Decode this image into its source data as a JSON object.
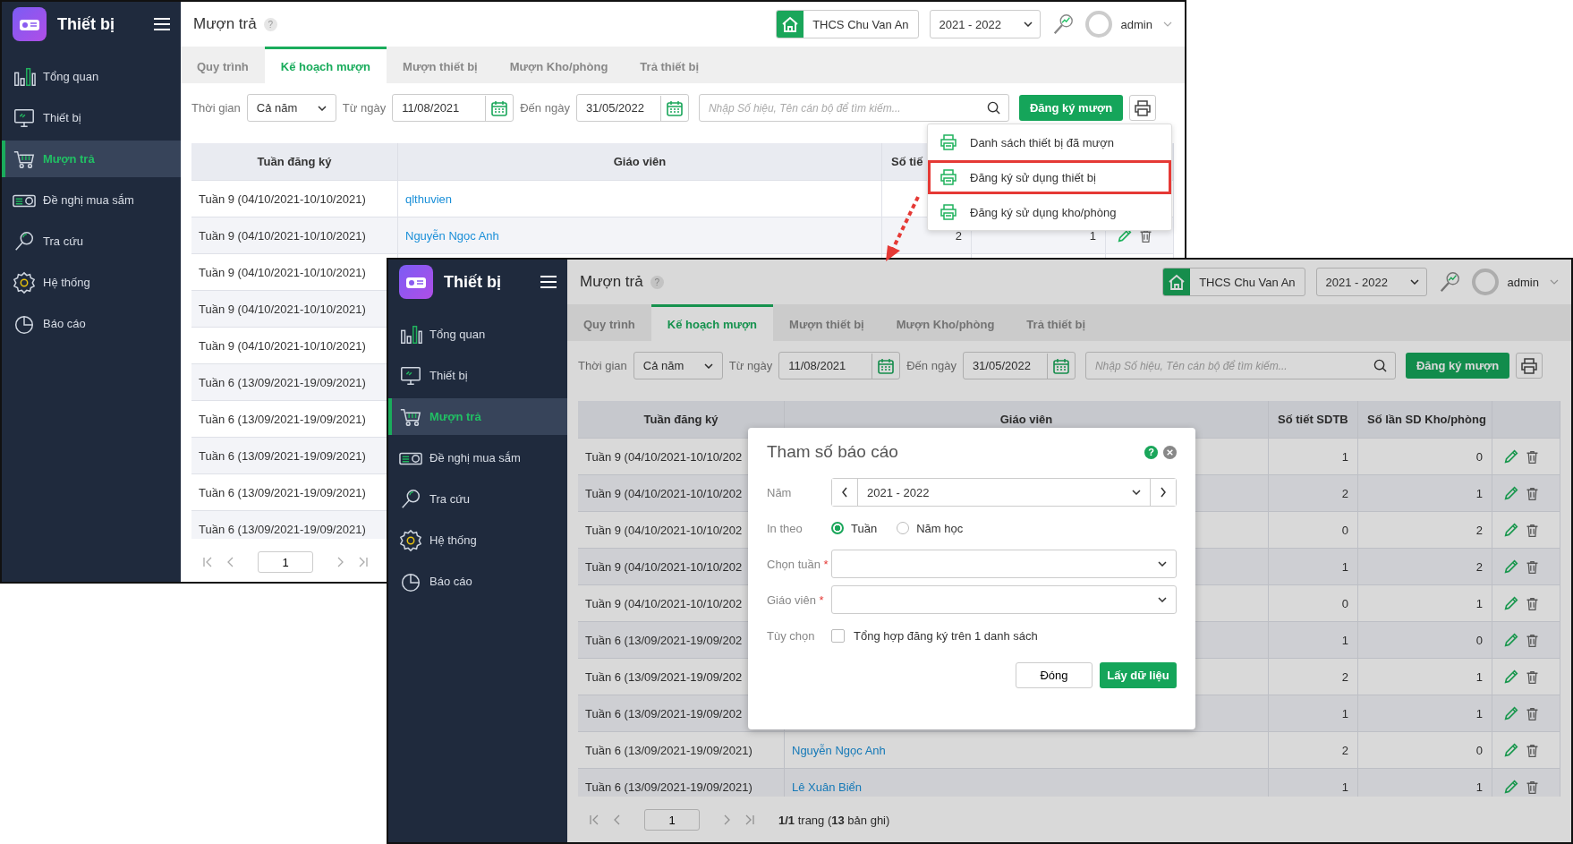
{
  "windows": [
    {
      "app_title": "Thiết bị",
      "nav": [
        {
          "label": "Tổng quan",
          "selected": false
        },
        {
          "label": "Thiết bị",
          "selected": false
        },
        {
          "label": "Mượn trả",
          "selected": true
        },
        {
          "label": "Đề nghị mua sắm",
          "selected": false
        },
        {
          "label": "Tra cứu",
          "selected": false
        },
        {
          "label": "Hệ thống",
          "selected": false
        },
        {
          "label": "Báo cáo",
          "selected": false
        }
      ],
      "page_title": "Mượn trả",
      "help_mark": "?",
      "school": "THCS Chu Van An",
      "year": "2021 - 2022",
      "user": "admin",
      "tabs": [
        {
          "label": "Quy trình",
          "selected": false
        },
        {
          "label": "Kế hoạch mượn",
          "selected": true
        },
        {
          "label": "Mượn thiết bị",
          "selected": false
        },
        {
          "label": "Mượn Kho/phòng",
          "selected": false
        },
        {
          "label": "Trả thiết bị",
          "selected": false
        }
      ],
      "filter": {
        "time_label": "Thời gian",
        "time_value": "Cả năm",
        "from_label": "Từ ngày",
        "from_value": "11/08/2021",
        "to_label": "Đến ngày",
        "to_value": "31/05/2022",
        "search_placeholder": "Nhập Số hiệu, Tên cán bộ để tìm kiếm...",
        "register_button": "Đăng ký mượn"
      },
      "columns": [
        "Tuần đăng ký",
        "Giáo viên",
        "Số tiế"
      ],
      "rows": [
        {
          "week": "Tuần 9 (04/10/2021-10/10/2021)",
          "teacher": "qlthuvien"
        },
        {
          "week": "Tuần 9 (04/10/2021-10/10/2021)",
          "teacher": "Nguyễn Ngọc Anh",
          "sessions": "2",
          "uses": "1"
        },
        {
          "week": "Tuần 9 (04/10/2021-10/10/2021)"
        },
        {
          "week": "Tuần 9 (04/10/2021-10/10/2021)"
        },
        {
          "week": "Tuần 9 (04/10/2021-10/10/2021)"
        },
        {
          "week": "Tuần 6 (13/09/2021-19/09/2021)"
        },
        {
          "week": "Tuần 6 (13/09/2021-19/09/2021)"
        },
        {
          "week": "Tuần 6 (13/09/2021-19/09/2021)"
        },
        {
          "week": "Tuần 6 (13/09/2021-19/09/2021)"
        },
        {
          "week": "Tuần 6 (13/09/2021-19/09/2021)"
        }
      ],
      "page_input": "1",
      "print_menu": [
        {
          "label": "Danh sách thiết bị đã mượn",
          "highlighted": false
        },
        {
          "label": "Đăng ký sử dụng thiết bị",
          "highlighted": true
        },
        {
          "label": "Đăng ký sử dụng kho/phòng",
          "highlighted": false
        }
      ]
    },
    {
      "app_title": "Thiết bị",
      "nav": [
        {
          "label": "Tổng quan",
          "selected": false
        },
        {
          "label": "Thiết bị",
          "selected": false
        },
        {
          "label": "Mượn trả",
          "selected": true
        },
        {
          "label": "Đề nghị mua sắm",
          "selected": false
        },
        {
          "label": "Tra cứu",
          "selected": false
        },
        {
          "label": "Hệ thống",
          "selected": false
        },
        {
          "label": "Báo cáo",
          "selected": false
        }
      ],
      "page_title": "Mượn trả",
      "help_mark": "?",
      "school": "THCS Chu Van An",
      "year": "2021 - 2022",
      "user": "admin",
      "tabs": [
        {
          "label": "Quy trình",
          "selected": false
        },
        {
          "label": "Kế hoạch mượn",
          "selected": true
        },
        {
          "label": "Mượn thiết bị",
          "selected": false
        },
        {
          "label": "Mượn Kho/phòng",
          "selected": false
        },
        {
          "label": "Trả thiết bị",
          "selected": false
        }
      ],
      "filter": {
        "time_label": "Thời gian",
        "time_value": "Cả năm",
        "from_label": "Từ ngày",
        "from_value": "11/08/2021",
        "to_label": "Đến ngày",
        "to_value": "31/05/2022",
        "search_placeholder": "Nhập Số hiệu, Tên cán bộ để tìm kiếm...",
        "register_button": "Đăng ký mượn"
      },
      "columns": [
        "Tuần đăng ký",
        "Giáo viên",
        "Số tiết SDTB",
        "Số lần SD Kho/phòng"
      ],
      "rows": [
        {
          "week": "Tuần 9 (04/10/2021-10/10/202",
          "sessions": "1",
          "uses": "0"
        },
        {
          "week": "Tuần 9 (04/10/2021-10/10/202",
          "sessions": "2",
          "uses": "1"
        },
        {
          "week": "Tuần 9 (04/10/2021-10/10/202",
          "sessions": "0",
          "uses": "2"
        },
        {
          "week": "Tuần 9 (04/10/2021-10/10/202",
          "sessions": "1",
          "uses": "2"
        },
        {
          "week": "Tuần 9 (04/10/2021-10/10/202",
          "sessions": "0",
          "uses": "1"
        },
        {
          "week": "Tuần 6 (13/09/2021-19/09/202",
          "sessions": "1",
          "uses": "0"
        },
        {
          "week": "Tuần 6 (13/09/2021-19/09/202",
          "sessions": "2",
          "uses": "1"
        },
        {
          "week": "Tuần 6 (13/09/2021-19/09/202",
          "sessions": "1",
          "uses": "1"
        },
        {
          "week": "Tuần 6 (13/09/2021-19/09/2021)",
          "teacher": "Nguyễn Ngọc Anh",
          "sessions": "2",
          "uses": "0"
        },
        {
          "week": "Tuần 6 (13/09/2021-19/09/2021)",
          "teacher": "Lê Xuân Biển",
          "sessions": "1",
          "uses": "1"
        }
      ],
      "page_input": "1",
      "page_info": "**1/1** trang (**13** bản ghi)",
      "dialog": {
        "title": "Tham số báo cáo",
        "help_mark": "?",
        "year_label": "Năm",
        "year_value": "2021 - 2022",
        "print_by_label": "In theo",
        "print_by_options": [
          {
            "label": "Tuần",
            "selected": true
          },
          {
            "label": "Năm học",
            "selected": false
          }
        ],
        "fields": [
          {
            "label": "Chọn tuần",
            "required_mark": "*"
          },
          {
            "label": "Giáo viên",
            "required_mark": "*"
          }
        ],
        "option_label": "Tùy chọn",
        "option_text": "Tổng hợp đăng ký trên 1 danh sách",
        "option_checked": false,
        "close_button": "Đóng",
        "submit_button": "Lấy dữ liệu"
      }
    }
  ]
}
